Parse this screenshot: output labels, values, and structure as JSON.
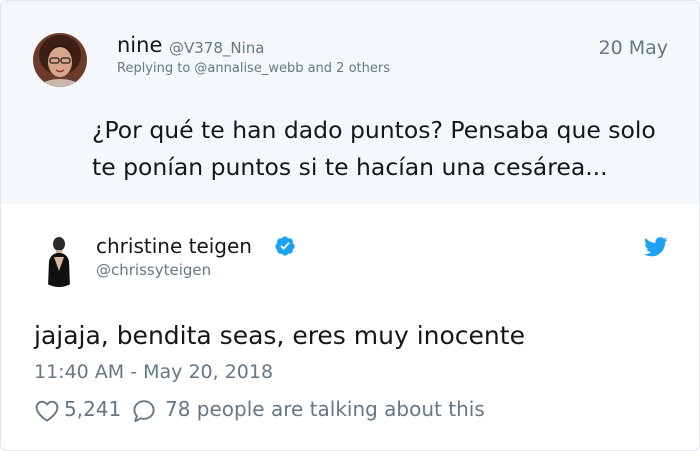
{
  "reply": {
    "name": "nine",
    "handle": "@V378_Nina",
    "date": "20 May",
    "replying_to": "Replying to @annalise_webb and 2 others",
    "text_line1": "¿Por qué te han dado puntos? Pensaba que solo",
    "text_line2": "te ponían puntos si te hacían una cesárea..."
  },
  "tweet": {
    "name": "christine teigen",
    "handle": "@chrissyteigen",
    "text": "jajaja, bendita seas, eres muy inocente",
    "timestamp": "11:40 AM - May 20, 2018",
    "likes": "5,241",
    "talking": "78 people are talking about this"
  },
  "colors": {
    "twitter_blue": "#1da1f2",
    "text_primary": "#14171a",
    "text_secondary": "#657786",
    "reply_background": "#f5f8fa"
  },
  "icons": {
    "verified": "verified-badge-icon",
    "brand": "twitter-bird-icon",
    "like": "heart-icon",
    "reply": "reply-bubble-icon"
  }
}
